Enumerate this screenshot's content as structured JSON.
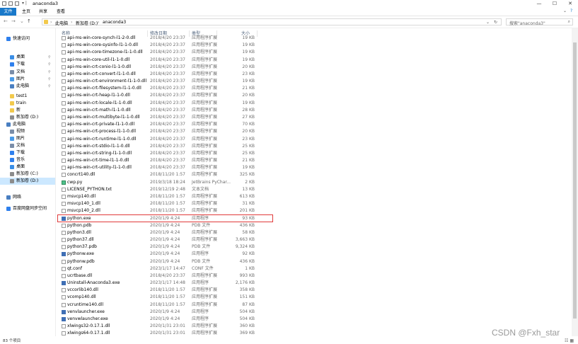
{
  "window": {
    "title": "anaconda3",
    "controls": [
      "—",
      "☐",
      "✕"
    ]
  },
  "ribbon": {
    "tabs": [
      "文件",
      "主页",
      "共享",
      "查看"
    ]
  },
  "address": {
    "back": "←",
    "forward": "→",
    "up_history": "⌄",
    "up": "↑",
    "crumbs": [
      "此电脑",
      "新加卷 (D:)",
      "anaconda3"
    ],
    "separator": "›",
    "refresh": "↻",
    "search_placeholder": "搜索\"anaconda3\""
  },
  "nav": {
    "items": [
      {
        "label": "快速访问",
        "icon": "star-icon",
        "color": "#2f80ed",
        "pinned": false,
        "selected": false
      },
      {
        "label": "桌面",
        "icon": "desktop-icon",
        "color": "#3a8ee6",
        "pinned": true,
        "selected": false
      },
      {
        "label": "下载",
        "icon": "download-icon",
        "color": "#2f80ed",
        "pinned": true,
        "selected": false
      },
      {
        "label": "文档",
        "icon": "document-icon",
        "color": "#7a8da8",
        "pinned": true,
        "selected": false
      },
      {
        "label": "图片",
        "icon": "picture-icon",
        "color": "#4a9be8",
        "pinned": true,
        "selected": false
      },
      {
        "label": "此电脑",
        "icon": "computer-icon",
        "color": "#4a7fc1",
        "pinned": true,
        "selected": false
      },
      {
        "label": "test1",
        "icon": "folder-icon",
        "color": "#f2c94c",
        "pinned": false,
        "selected": false
      },
      {
        "label": "train",
        "icon": "folder-icon",
        "color": "#f2c94c",
        "pinned": false,
        "selected": false
      },
      {
        "label": "新",
        "icon": "folder-icon",
        "color": "#f2c94c",
        "pinned": false,
        "selected": false
      },
      {
        "label": "新加卷 (D:)",
        "icon": "drive-icon",
        "color": "#8c8c8c",
        "pinned": false,
        "selected": false
      },
      {
        "label": "此电脑",
        "icon": "computer-icon",
        "color": "#4a7fc1",
        "pinned": false,
        "selected": false
      },
      {
        "label": "视频",
        "icon": "video-icon",
        "color": "#7a8da8",
        "pinned": false,
        "selected": false
      },
      {
        "label": "图片",
        "icon": "picture-icon",
        "color": "#4a9be8",
        "pinned": false,
        "selected": false
      },
      {
        "label": "文档",
        "icon": "document-icon",
        "color": "#7a8da8",
        "pinned": false,
        "selected": false
      },
      {
        "label": "下载",
        "icon": "download-icon",
        "color": "#2f80ed",
        "pinned": false,
        "selected": false
      },
      {
        "label": "音乐",
        "icon": "music-icon",
        "color": "#2f80ed",
        "pinned": false,
        "selected": false
      },
      {
        "label": "桌面",
        "icon": "desktop-icon",
        "color": "#3a8ee6",
        "pinned": false,
        "selected": false
      },
      {
        "label": "新加卷 (C:)",
        "icon": "drive-icon",
        "color": "#8c8c8c",
        "pinned": false,
        "selected": false
      },
      {
        "label": "新加卷 (D:)",
        "icon": "drive-icon",
        "color": "#8c8c8c",
        "pinned": false,
        "selected": true
      },
      {
        "label": "网络",
        "icon": "network-icon",
        "color": "#4a7fc1",
        "pinned": false,
        "selected": false
      },
      {
        "label": "百度网盘同步空间",
        "icon": "cloud-icon",
        "color": "#2f80ed",
        "pinned": false,
        "selected": false
      }
    ]
  },
  "columns": {
    "name": "名称",
    "date": "修改日期",
    "type": "类型",
    "size": "大小"
  },
  "files": [
    {
      "name": "api-ms-win-core-synch-l1-2-0.dll",
      "date": "2018/4/20 23:37",
      "type": "应用程序扩展",
      "size": "19 KB"
    },
    {
      "name": "api-ms-win-core-sysinfo-l1-1-0.dll",
      "date": "2018/4/20 23:37",
      "type": "应用程序扩展",
      "size": "19 KB"
    },
    {
      "name": "api-ms-win-core-timezone-l1-1-0.dll",
      "date": "2018/4/20 23:37",
      "type": "应用程序扩展",
      "size": "19 KB"
    },
    {
      "name": "api-ms-win-core-util-l1-1-0.dll",
      "date": "2018/4/20 23:37",
      "type": "应用程序扩展",
      "size": "19 KB"
    },
    {
      "name": "api-ms-win-crt-conio-l1-1-0.dll",
      "date": "2018/4/20 23:37",
      "type": "应用程序扩展",
      "size": "20 KB"
    },
    {
      "name": "api-ms-win-crt-convert-l1-1-0.dll",
      "date": "2018/4/20 23:37",
      "type": "应用程序扩展",
      "size": "23 KB"
    },
    {
      "name": "api-ms-win-crt-environment-l1-1-0.dll",
      "date": "2018/4/20 23:37",
      "type": "应用程序扩展",
      "size": "19 KB"
    },
    {
      "name": "api-ms-win-crt-filesystem-l1-1-0.dll",
      "date": "2018/4/20 23:37",
      "type": "应用程序扩展",
      "size": "21 KB"
    },
    {
      "name": "api-ms-win-crt-heap-l1-1-0.dll",
      "date": "2018/4/20 23:37",
      "type": "应用程序扩展",
      "size": "20 KB"
    },
    {
      "name": "api-ms-win-crt-locale-l1-1-0.dll",
      "date": "2018/4/20 23:37",
      "type": "应用程序扩展",
      "size": "19 KB"
    },
    {
      "name": "api-ms-win-crt-math-l1-1-0.dll",
      "date": "2018/4/20 23:37",
      "type": "应用程序扩展",
      "size": "28 KB"
    },
    {
      "name": "api-ms-win-crt-multibyte-l1-1-0.dll",
      "date": "2018/4/20 23:37",
      "type": "应用程序扩展",
      "size": "27 KB"
    },
    {
      "name": "api-ms-win-crt-private-l1-1-0.dll",
      "date": "2018/4/20 23:37",
      "type": "应用程序扩展",
      "size": "70 KB"
    },
    {
      "name": "api-ms-win-crt-process-l1-1-0.dll",
      "date": "2018/4/20 23:37",
      "type": "应用程序扩展",
      "size": "20 KB"
    },
    {
      "name": "api-ms-win-crt-runtime-l1-1-0.dll",
      "date": "2018/4/20 23:37",
      "type": "应用程序扩展",
      "size": "23 KB"
    },
    {
      "name": "api-ms-win-crt-stdio-l1-1-0.dll",
      "date": "2018/4/20 23:37",
      "type": "应用程序扩展",
      "size": "25 KB"
    },
    {
      "name": "api-ms-win-crt-string-l1-1-0.dll",
      "date": "2018/4/20 23:37",
      "type": "应用程序扩展",
      "size": "25 KB"
    },
    {
      "name": "api-ms-win-crt-time-l1-1-0.dll",
      "date": "2018/4/20 23:37",
      "type": "应用程序扩展",
      "size": "21 KB"
    },
    {
      "name": "api-ms-win-crt-utility-l1-1-0.dll",
      "date": "2018/4/20 23:37",
      "type": "应用程序扩展",
      "size": "19 KB"
    },
    {
      "name": "concrt140.dll",
      "date": "2018/11/20 1:57",
      "type": "应用程序扩展",
      "size": "325 KB"
    },
    {
      "name": "cwp.py",
      "date": "2019/3/18 18:24",
      "type": "JetBrains PyChar...",
      "size": "2 KB"
    },
    {
      "name": "LICENSE_PYTHON.txt",
      "date": "2019/12/19 2:48",
      "type": "文本文档",
      "size": "13 KB"
    },
    {
      "name": "msvcp140.dll",
      "date": "2018/11/20 1:57",
      "type": "应用程序扩展",
      "size": "613 KB"
    },
    {
      "name": "msvcp140_1.dll",
      "date": "2018/11/20 1:57",
      "type": "应用程序扩展",
      "size": "31 KB"
    },
    {
      "name": "msvcp140_2.dll",
      "date": "2018/11/20 1:57",
      "type": "应用程序扩展",
      "size": "201 KB"
    },
    {
      "name": "python.exe",
      "date": "2020/1/9 4:24",
      "type": "应用程序",
      "size": "93 KB"
    },
    {
      "name": "python.pdb",
      "date": "2020/1/9 4:24",
      "type": "PDB 文件",
      "size": "436 KB"
    },
    {
      "name": "python3.dll",
      "date": "2020/1/9 4:24",
      "type": "应用程序扩展",
      "size": "58 KB"
    },
    {
      "name": "python37.dll",
      "date": "2020/1/9 4:24",
      "type": "应用程序扩展",
      "size": "3,663 KB"
    },
    {
      "name": "python37.pdb",
      "date": "2020/1/9 4:24",
      "type": "PDB 文件",
      "size": "9,324 KB"
    },
    {
      "name": "pythonw.exe",
      "date": "2020/1/9 4:24",
      "type": "应用程序",
      "size": "92 KB"
    },
    {
      "name": "pythonw.pdb",
      "date": "2020/1/9 4:24",
      "type": "PDB 文件",
      "size": "436 KB"
    },
    {
      "name": "qt.conf",
      "date": "2023/1/17 14:47",
      "type": "CONF 文件",
      "size": "1 KB"
    },
    {
      "name": "ucrtbase.dll",
      "date": "2018/4/20 23:37",
      "type": "应用程序扩展",
      "size": "993 KB"
    },
    {
      "name": "Uninstall-Anaconda3.exe",
      "date": "2023/1/17 14:48",
      "type": "应用程序",
      "size": "2,176 KB"
    },
    {
      "name": "vccorlib140.dll",
      "date": "2018/11/20 1:57",
      "type": "应用程序扩展",
      "size": "358 KB"
    },
    {
      "name": "vcomp140.dll",
      "date": "2018/11/20 1:57",
      "type": "应用程序扩展",
      "size": "151 KB"
    },
    {
      "name": "vcruntime140.dll",
      "date": "2018/11/20 1:57",
      "type": "应用程序扩展",
      "size": "87 KB"
    },
    {
      "name": "venvlauncher.exe",
      "date": "2020/1/9 4:24",
      "type": "应用程序",
      "size": "504 KB"
    },
    {
      "name": "venvwlauncher.exe",
      "date": "2020/1/9 4:24",
      "type": "应用程序",
      "size": "504 KB"
    },
    {
      "name": "xlwings32-0.17.1.dll",
      "date": "2020/1/31 23:01",
      "type": "应用程序扩展",
      "size": "360 KB"
    },
    {
      "name": "xlwings64-0.17.1.dll",
      "date": "2020/1/31 23:01",
      "type": "应用程序扩展",
      "size": "369 KB"
    }
  ],
  "highlighted_file": "python.exe",
  "status": {
    "count": "83 个项目"
  },
  "watermark": "CSDN @Fxh_star"
}
